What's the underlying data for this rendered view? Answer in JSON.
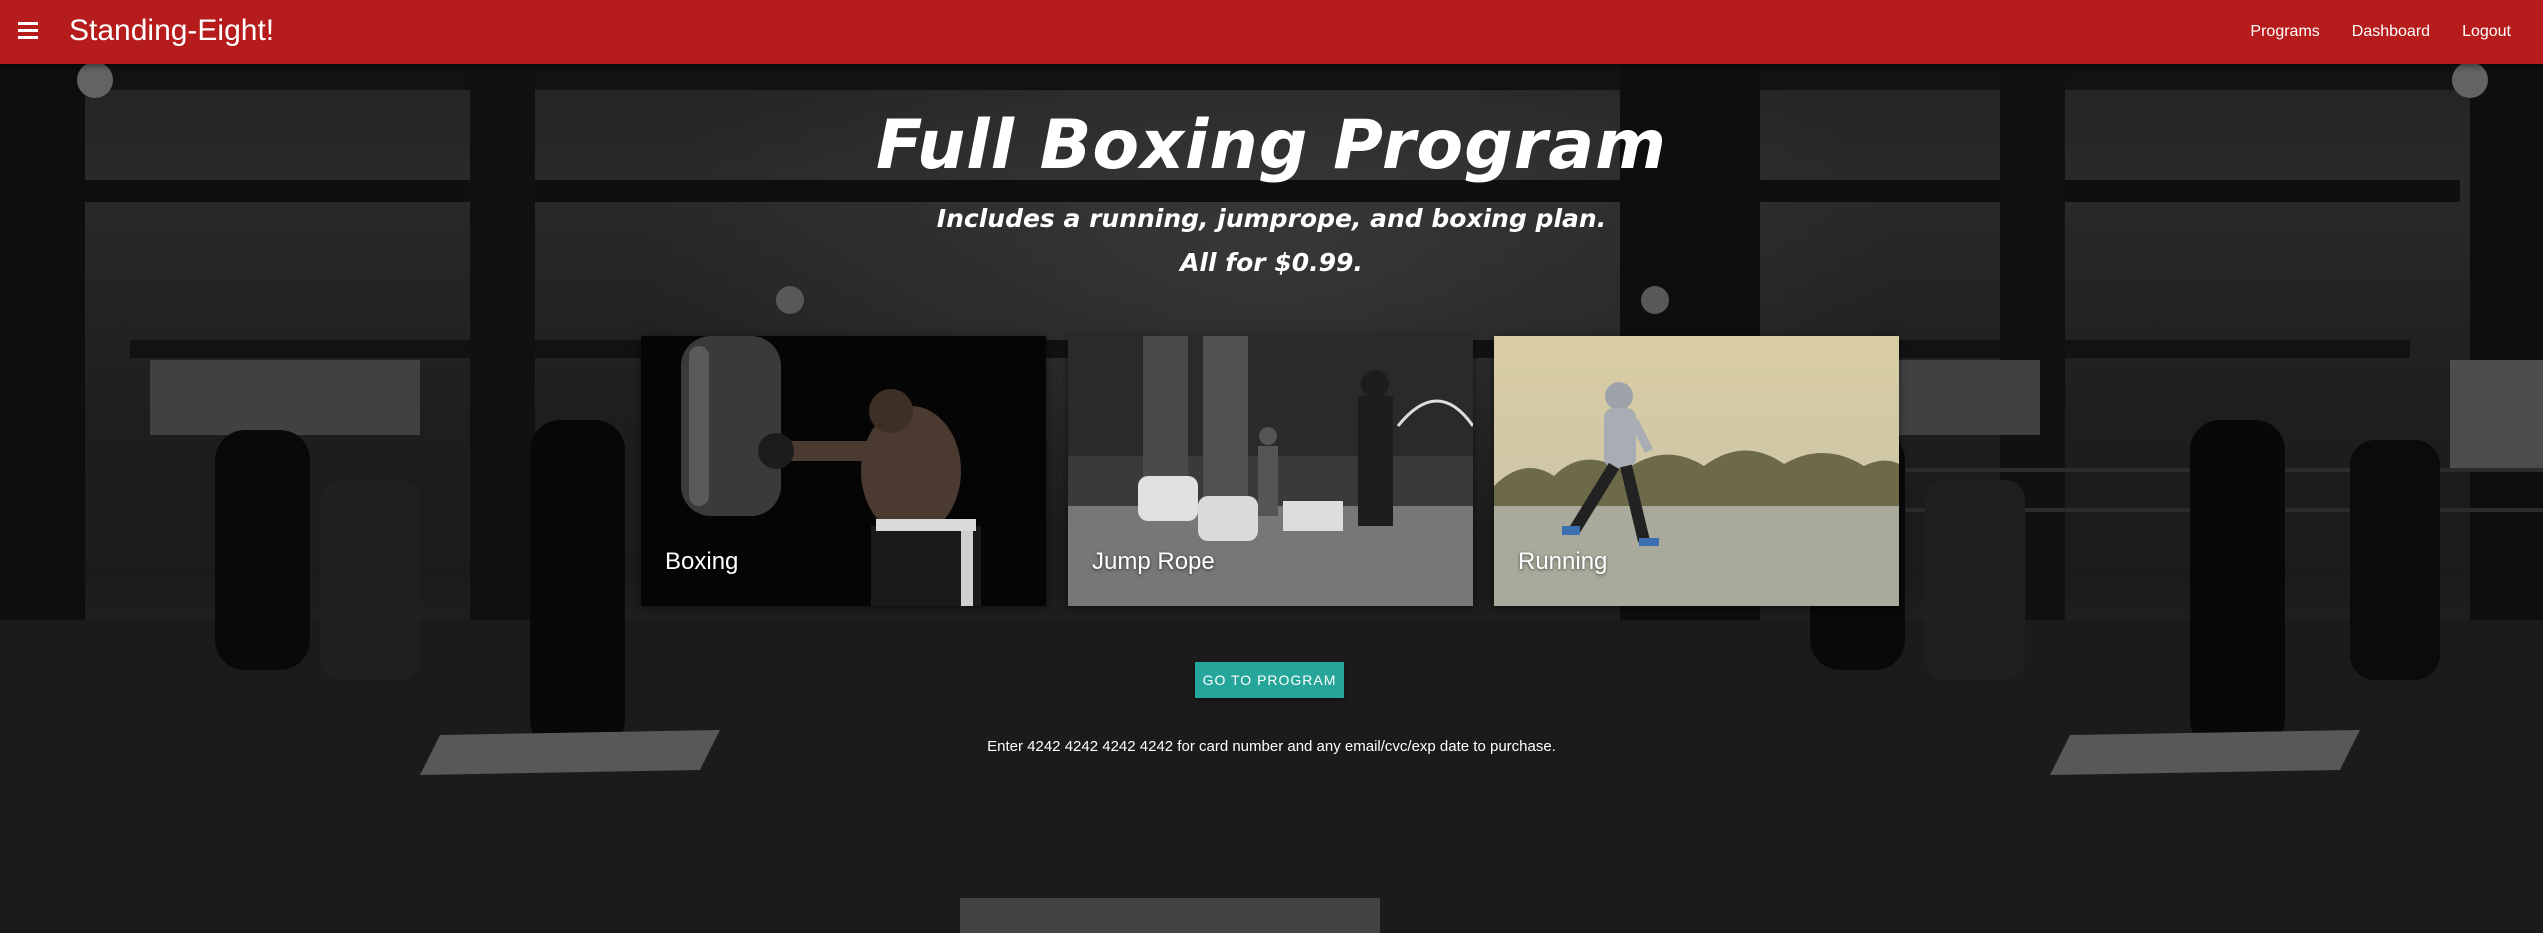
{
  "nav": {
    "brand": "Standing-Eight!",
    "links": [
      "Programs",
      "Dashboard",
      "Logout"
    ]
  },
  "hero": {
    "title": "Full Boxing Program",
    "subtitle_line1": "Includes a running, jumprope, and boxing plan.",
    "subtitle_line2": "All for $0.99."
  },
  "cards": [
    {
      "label": "Boxing"
    },
    {
      "label": "Jump Rope"
    },
    {
      "label": "Running"
    }
  ],
  "cta": {
    "label": "GO TO PROGRAM"
  },
  "note": "Enter 4242 4242 4242 4242 for card number and any email/cvc/exp date to purchase.",
  "colors": {
    "navbar": "#b71c1c",
    "button": "#26a69a",
    "text": "#ffffff"
  },
  "icons": {
    "menu": "hamburger-menu-icon"
  }
}
